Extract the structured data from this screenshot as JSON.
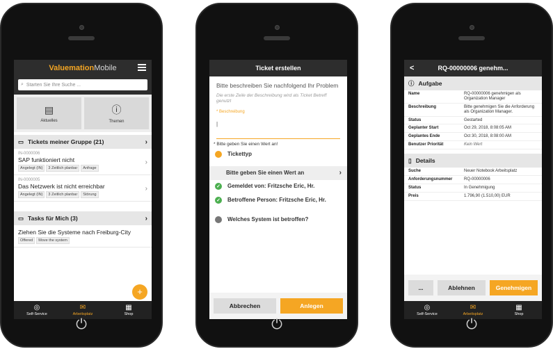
{
  "phone1": {
    "brand_strong": "Valuemation",
    "brand_light": "Mobile",
    "search_placeholder": "Starten Sie Ihre Suche ...",
    "tiles": [
      {
        "label": "Aktuelles",
        "icon": "newspaper-icon"
      },
      {
        "label": "Themen",
        "icon": "question-circle-icon"
      }
    ],
    "section1_title": "Tickets meiner Gruppe (21)",
    "tickets": [
      {
        "id": "IN-0000006",
        "title": "SAP funktioniert nicht",
        "tags": [
          "Angelegt (IN)",
          "3 Zeitlich planbar",
          "Anfrage"
        ]
      },
      {
        "id": "IN-0000005",
        "title": "Das Netzwerk ist nicht erreichbar",
        "tags": [
          "Angelegt (IN)",
          "3 Zeitlich planbar",
          "Störung"
        ]
      }
    ],
    "section2_title": "Tasks für Mich (3)",
    "task": {
      "title": "Ziehen Sie die Systeme nach Freiburg-City",
      "tags": [
        "Offered",
        "Move the system"
      ]
    },
    "fab_label": "+",
    "nav": [
      {
        "label": "Self-Service",
        "icon": "lifebuoy-icon"
      },
      {
        "label": "Arbeitsplatz",
        "icon": "envelope-icon"
      },
      {
        "label": "Shop",
        "icon": "shop-icon"
      }
    ]
  },
  "phone2": {
    "title": "Ticket erstellen",
    "prompt": "Bitte beschreiben Sie nachfolgend Ihr Problem",
    "hint": "Die erste Zeile der Beschreibung wird als Ticket Betreff genutzt",
    "field_label": "* Beschreibung",
    "field_value": "|",
    "error": "* Bitte geben Sie einen Wert an!",
    "steps": [
      {
        "label": "Tickettyp",
        "state": "orange"
      },
      {
        "label": "Gemeldet von: Fritzsche Eric, Hr.",
        "state": "green"
      },
      {
        "label": "Betroffene Person: Fritzsche Eric, Hr.",
        "state": "green"
      },
      {
        "label": "Welches System ist betroffen?",
        "state": "grey"
      }
    ],
    "picker_label": "Bitte geben Sie einen Wert an",
    "cancel": "Abbrechen",
    "submit": "Anlegen"
  },
  "phone3": {
    "title": "RQ-00000006 genehm...",
    "back": "<",
    "task_section": "Aufgabe",
    "task_rows": [
      {
        "k": "Name",
        "v": "RQ-00000006 genehmigen als Organization Manager"
      },
      {
        "k": "Beschreibung",
        "v": "Bitte genehmigen Sie die Anforderung als Organization Manager."
      },
      {
        "k": "Status",
        "v": "Gestarted"
      },
      {
        "k": "Geplanter Start",
        "v": "Oct 29, 2018, 8:08:05 AM"
      },
      {
        "k": "Geplantes Ende",
        "v": "Oct 30, 2018, 8:08:00 AM"
      },
      {
        "k": "Benutzer Priorität",
        "v": "Kein Wert"
      }
    ],
    "details_section": "Details",
    "detail_rows": [
      {
        "k": "Suche",
        "v": "Neuer Notebook Arbeitsplatz"
      },
      {
        "k": "Anforderungsnummer",
        "v": "RQ-00000006"
      },
      {
        "k": "Status",
        "v": "In Genehmigung"
      },
      {
        "k": "Preis",
        "v": "1.796,90 (1.510,00) EUR"
      }
    ],
    "more": "...",
    "reject": "Ablehnen",
    "approve": "Genehmigen"
  },
  "power_glyph": "⏻"
}
